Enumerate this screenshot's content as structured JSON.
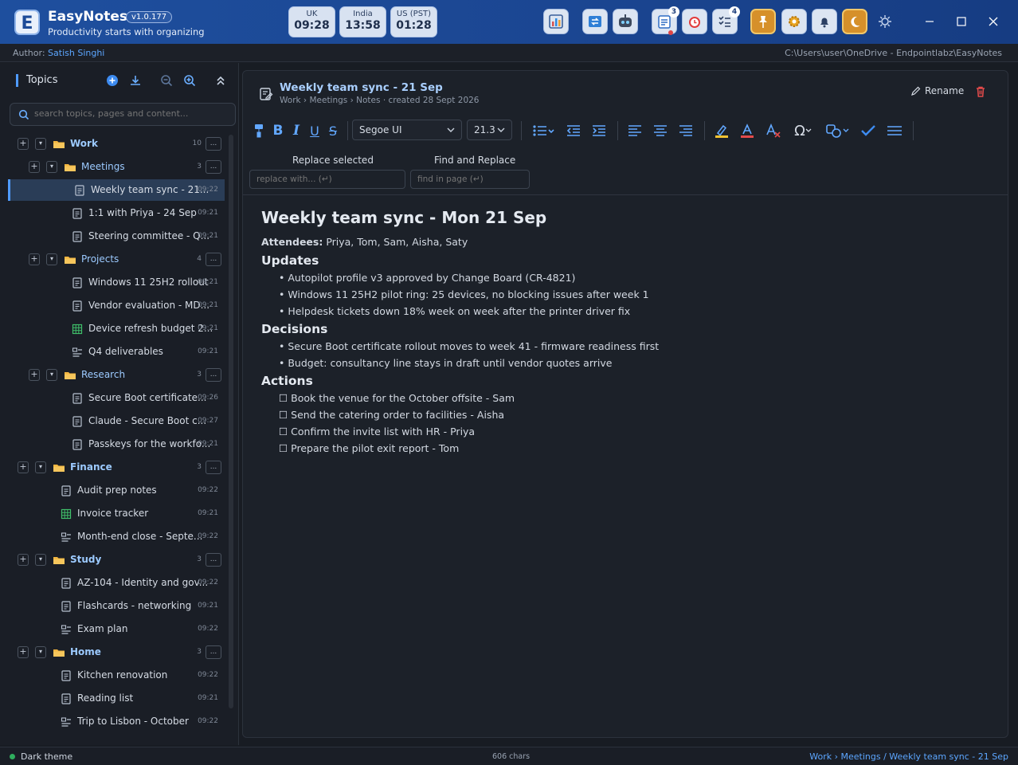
{
  "app": {
    "name": "EasyNotes",
    "version": "v1.0.177",
    "tagline": "Productivity starts with organizing",
    "logo_letter": "E"
  },
  "clocks": [
    {
      "label": "UK",
      "time": "09:28"
    },
    {
      "label": "India",
      "time": "13:58"
    },
    {
      "label": "US (PST)",
      "time": "01:28"
    }
  ],
  "toolbar_badges": {
    "tasks": "3",
    "checklist": "4"
  },
  "info": {
    "author_label": "Author: ",
    "author_name": "Satish Singhi",
    "path": "C:\\Users\\user\\OneDrive - Endpointlabz\\EasyNotes"
  },
  "sidebar": {
    "title": "Topics",
    "search_placeholder": "search topics, pages and content...",
    "more": "..."
  },
  "tree": [
    {
      "kind": "root",
      "label": "Work",
      "count": "10"
    },
    {
      "kind": "sub",
      "label": "Meetings",
      "count": "3"
    },
    {
      "kind": "page",
      "level": 2,
      "icon": "doc",
      "label": "Weekly team sync - 21...",
      "time": "09:22",
      "selected": true
    },
    {
      "kind": "page",
      "level": 2,
      "icon": "doc",
      "label": "1:1 with Priya - 24 Sep",
      "time": "09:21"
    },
    {
      "kind": "page",
      "level": 2,
      "icon": "doc",
      "label": "Steering committee - Q...",
      "time": "09:21"
    },
    {
      "kind": "sub",
      "label": "Projects",
      "count": "4"
    },
    {
      "kind": "page",
      "level": 2,
      "icon": "doc",
      "label": "Windows 11 25H2 rollout",
      "time": "09:21"
    },
    {
      "kind": "page",
      "level": 2,
      "icon": "doc",
      "label": "Vendor evaluation - MD...",
      "time": "09:21"
    },
    {
      "kind": "page",
      "level": 2,
      "icon": "table",
      "label": "Device refresh budget 2...",
      "time": "09:21"
    },
    {
      "kind": "page",
      "level": 2,
      "icon": "plan",
      "label": "Q4 deliverables",
      "time": "09:21"
    },
    {
      "kind": "sub",
      "label": "Research",
      "count": "3"
    },
    {
      "kind": "page",
      "level": 2,
      "icon": "doc",
      "label": "Secure Boot certificate...",
      "time": "09:26"
    },
    {
      "kind": "page",
      "level": 2,
      "icon": "doc",
      "label": "Claude - Secure Boot c...",
      "time": "09:27"
    },
    {
      "kind": "page",
      "level": 2,
      "icon": "doc",
      "label": "Passkeys for the workfo...",
      "time": "09:21"
    },
    {
      "kind": "root",
      "label": "Finance",
      "count": "3"
    },
    {
      "kind": "page",
      "level": 1,
      "icon": "doc",
      "label": "Audit prep notes",
      "time": "09:22"
    },
    {
      "kind": "page",
      "level": 1,
      "icon": "table",
      "label": "Invoice tracker",
      "time": "09:21"
    },
    {
      "kind": "page",
      "level": 1,
      "icon": "plan",
      "label": "Month-end close - Septe...",
      "time": "09:22"
    },
    {
      "kind": "root",
      "label": "Study",
      "count": "3"
    },
    {
      "kind": "page",
      "level": 1,
      "icon": "doc",
      "label": "AZ-104 - Identity and gov...",
      "time": "09:22"
    },
    {
      "kind": "page",
      "level": 1,
      "icon": "doc",
      "label": "Flashcards - networking",
      "time": "09:21"
    },
    {
      "kind": "page",
      "level": 1,
      "icon": "plan",
      "label": "Exam plan",
      "time": "09:22"
    },
    {
      "kind": "root",
      "label": "Home",
      "count": "3"
    },
    {
      "kind": "page",
      "level": 1,
      "icon": "doc",
      "label": "Kitchen renovation",
      "time": "09:22"
    },
    {
      "kind": "page",
      "level": 1,
      "icon": "doc",
      "label": "Reading list",
      "time": "09:21"
    },
    {
      "kind": "page",
      "level": 1,
      "icon": "plan",
      "label": "Trip to Lisbon - October",
      "time": "09:22"
    }
  ],
  "page": {
    "title": "Weekly team sync - 21 Sep",
    "crumb_path": "Work › Meetings  ›  Notes",
    "crumb_created": "·  created 28 Sept 2026",
    "rename": "Rename"
  },
  "editor": {
    "font": "Segoe UI",
    "size": "21.3",
    "replace_heading": "Replace selected",
    "find_heading": "Find and Replace",
    "replace_placeholder": "replace with... (↵)",
    "find_placeholder": "find in page (↵)"
  },
  "doc": {
    "title": "Weekly team sync - Mon 21 Sep",
    "attendees_label": "Attendees:",
    "attendees": " Priya, Tom, Sam, Aisha, Saty",
    "updates_heading": "Updates",
    "updates": [
      "• Autopilot profile v3 approved by Change Board (CR-4821)",
      "• Windows 11 25H2 pilot ring: 25 devices, no blocking issues after week 1",
      "• Helpdesk tickets down 18% week on week after the printer driver fix"
    ],
    "decisions_heading": "Decisions",
    "decisions": [
      "• Secure Boot certificate rollout moves to week 41 - firmware readiness first",
      "• Budget: consultancy line stays in draft until vendor quotes arrive"
    ],
    "actions_heading": "Actions",
    "actions": [
      "☐ Book the venue for the October offsite - Sam",
      "☐ Send the catering order to facilities - Aisha",
      "☐ Confirm the invite list with HR - Priya",
      "☐ Prepare the pilot exit report - Tom"
    ]
  },
  "status": {
    "theme": "Dark theme",
    "chars": "606 chars",
    "crumb": "Work › Meetings / Weekly team sync - 21 Sep"
  }
}
